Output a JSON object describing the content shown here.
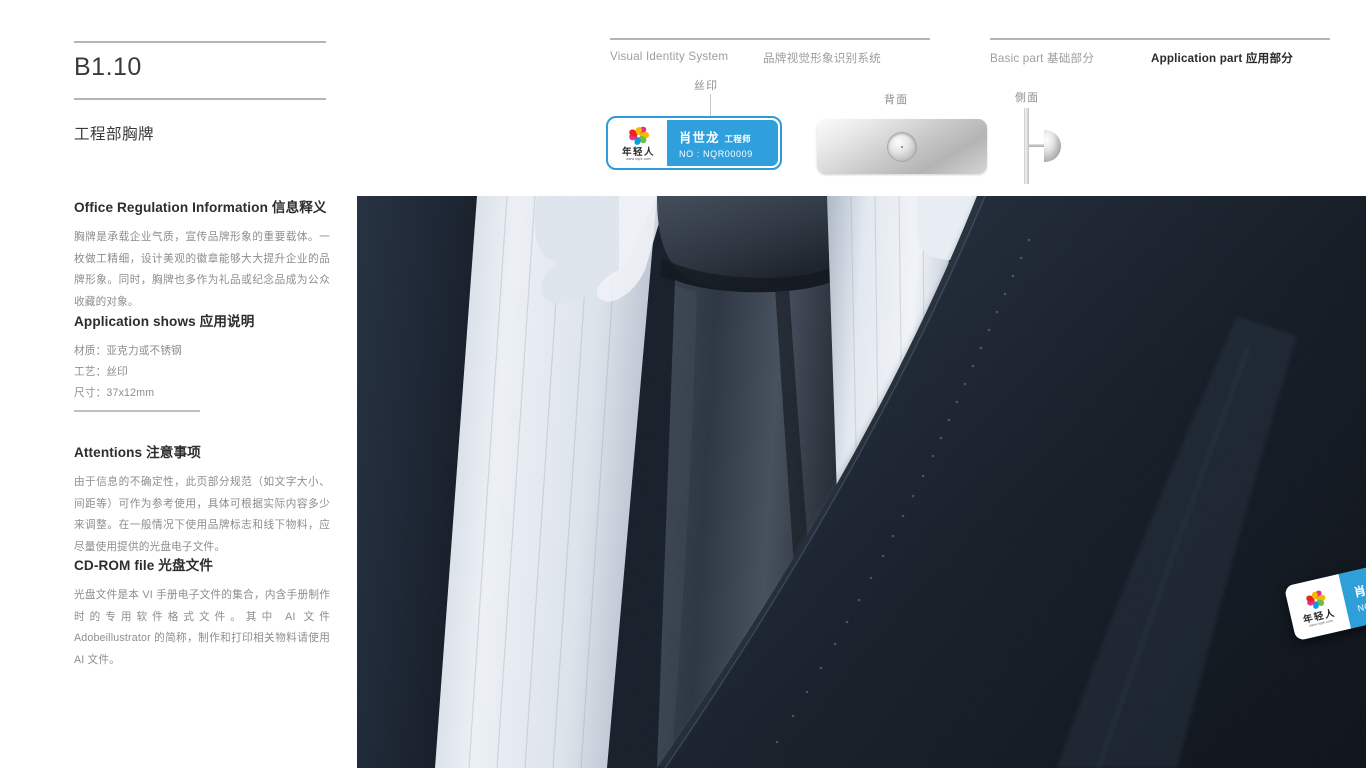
{
  "page": {
    "code": "B1.10",
    "subject_title": "工程部胸牌"
  },
  "header": {
    "vis_en": "Visual Identity System",
    "vis_cn": "品牌视觉形象识别系统",
    "basic_part": "Basic part  基础部分",
    "application_part": "Application part  应用部分"
  },
  "sections": {
    "office": {
      "heading": "Office Regulation Information 信息释义",
      "body": "胸牌是承载企业气质，宣传品牌形象的重要载体。一枚做工精细，设计美观的徽章能够大大提升企业的品牌形象。同时，胸牌也多作为礼品或纪念品成为公众收藏的对象。"
    },
    "application": {
      "heading": "Application shows 应用说明",
      "line1": "材质：亚克力或不锈钢",
      "line2": "工艺：丝印",
      "line3": "尺寸：37x12mm"
    },
    "attentions": {
      "heading": "Attentions 注意事项",
      "body": "由于信息的不确定性，此页部分规范（如文字大小、间距等）可作为参考使用，具体可根据实际内容多少来调整。在一般情况下使用品牌标志和线下物料，应尽量使用提供的光盘电子文件。"
    },
    "cdrom": {
      "heading": "CD-ROM file 光盘文件",
      "body": "光盘文件是本 VI 手册电子文件的集合，内含手册制作时的专用软件格式文件。其中 AI 文件 Adobeillustrator 的简称，制作和打印相关物料请使用 AI 文件。"
    }
  },
  "mockups": {
    "silk_label": "丝印",
    "back_label": "背面",
    "side_label": "側面"
  },
  "badge": {
    "name": "肖世龙",
    "role": "工程师",
    "number": "NO : NQR00009",
    "logo_cn": "年轻人",
    "logo_url": "www.nqrk.com"
  },
  "colors": {
    "badge_blue": "#2fa0dc",
    "badge_border": "#2c9adb",
    "rule_gray": "#b5b5b5",
    "body_text": "#8d8d8d",
    "heading_text": "#2d2d2d",
    "suit_navy": "#17202c"
  }
}
